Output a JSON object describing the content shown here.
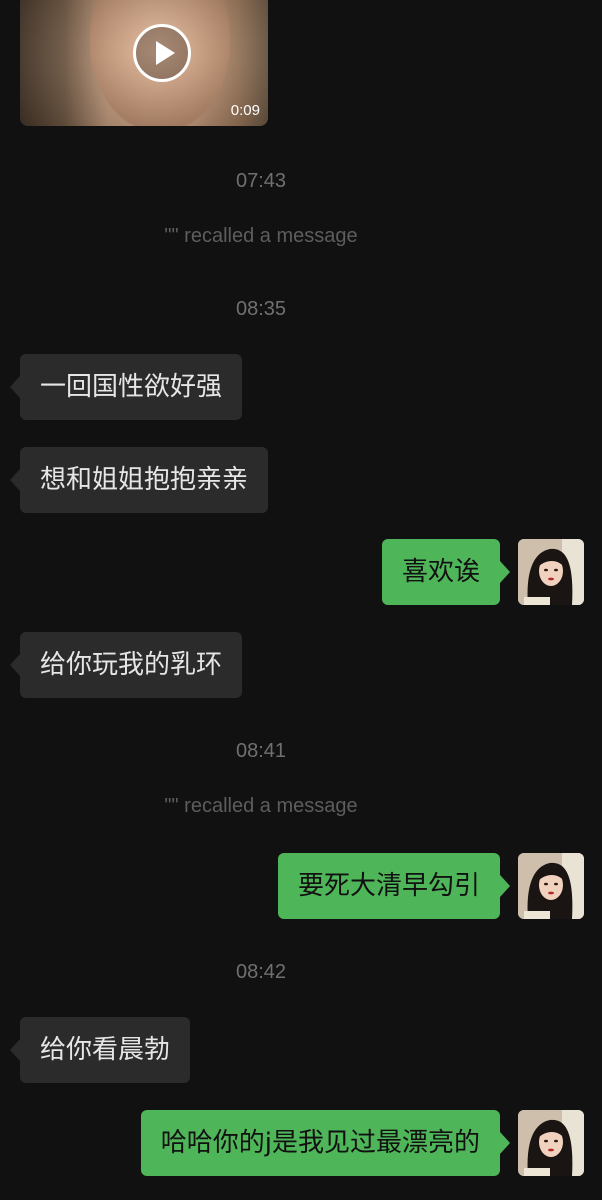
{
  "video": {
    "duration": "0:09",
    "play_icon": "play-icon"
  },
  "timestamps": [
    "07:43",
    "08:35",
    "08:41",
    "08:42"
  ],
  "recalled_notice": "\"\" recalled a message",
  "messages": [
    {
      "side": "in",
      "text": "一回国性欲好强"
    },
    {
      "side": "in",
      "text": "想和姐姐抱抱亲亲"
    },
    {
      "side": "out",
      "text": "喜欢诶"
    },
    {
      "side": "in",
      "text": "给你玩我的乳环"
    },
    {
      "side": "out",
      "text": "要死大清早勾引"
    },
    {
      "side": "in",
      "text": "给你看晨勃"
    },
    {
      "side": "out",
      "text": "哈哈你的j是我见过最漂亮的"
    }
  ],
  "colors": {
    "background": "#111111",
    "incoming_bubble": "#2b2b2b",
    "outgoing_bubble": "#4fb559",
    "timestamp_text": "#707070"
  }
}
